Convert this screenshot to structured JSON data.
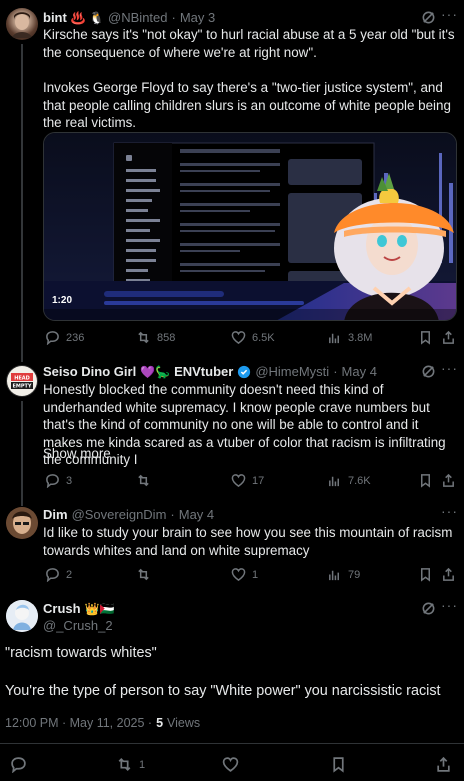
{
  "tweet1": {
    "name": "bint",
    "handle": "@NBinted",
    "sep": "·",
    "date": "May 3",
    "emoji": "♨️ 🐧",
    "text1": "Kirsche says it's \"not okay\" to hurl racial abuse at a 5 year old \"but it's the consequence of where we're at right now\".",
    "text2": "Invokes George Floyd to say there's a \"two-tier justice system\", and that people calling children slurs is an outcome of white people being the real victims.",
    "video_time": "1:20",
    "replies": "236",
    "reposts": "858",
    "likes": "6.5K",
    "views": "3.8M"
  },
  "tweet2": {
    "name": "Seiso Dino Girl",
    "name_emoji": "💜🦕",
    "name_suffix": "ENVtuber",
    "handle": "@HimeMysti",
    "sep": "·",
    "date": "May 4",
    "text": "Honestly blocked the community doesn't need this kind of underhanded white supremacy. I know people crave numbers but that's the kind of community no one will be able to control and it makes me kinda scared as a vtuber of color that racism is infiltrating the community I",
    "show_more": "Show more",
    "replies": "3",
    "reposts": "",
    "likes": "17",
    "views": "7.6K"
  },
  "tweet3": {
    "name": "Dim",
    "handle": "@SovereignDim",
    "sep": "·",
    "date": "May 4",
    "text": "Id like to study your brain to see how you see this mountain of racism towards whites and land on white supremacy",
    "replies": "2",
    "reposts": "",
    "likes": "1",
    "views": "79"
  },
  "tweet4": {
    "name": "Crush",
    "name_emoji": "👑🇵🇸",
    "handle": "@_Crush_2",
    "text1": "\"racism towards whites\"",
    "text2": "You're the type of person to say \"White power\" you narcissistic racist",
    "time": "12:00 PM · May 11, 2025 ·",
    "views_count": "5",
    "views_label": "Views",
    "reposts": "1"
  },
  "colors": {
    "background": "#000000",
    "text": "#e7e9ea",
    "muted": "#71767b",
    "link": "#1d9bf0",
    "divider": "#2f3336"
  }
}
